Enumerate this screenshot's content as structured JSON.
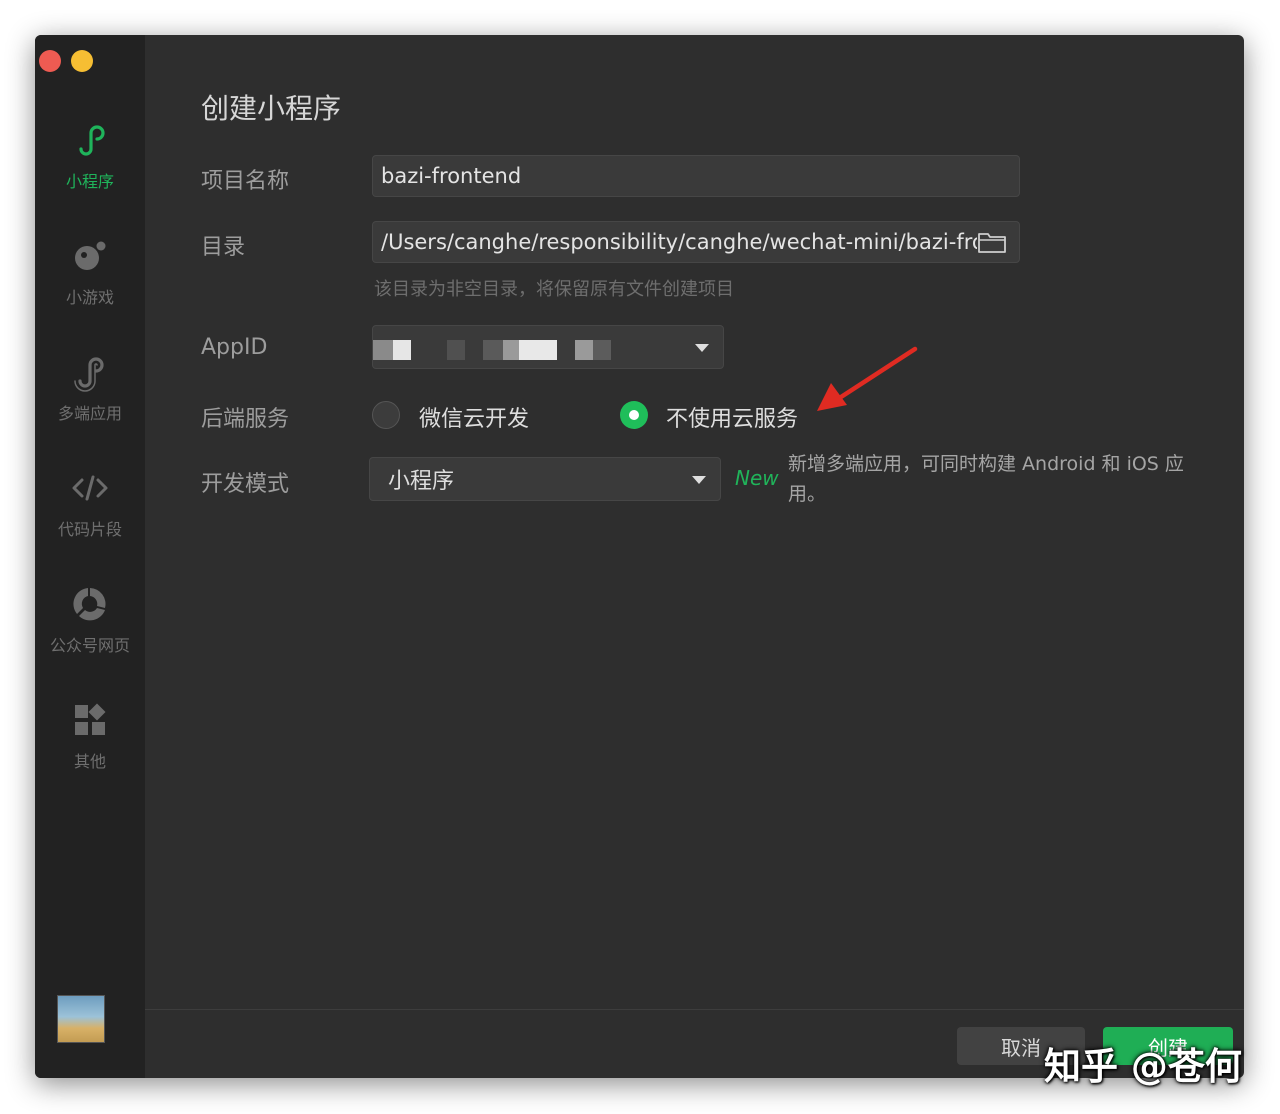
{
  "sidebar": {
    "items": [
      {
        "label": "小程序",
        "icon": "miniprogram-icon",
        "active": true
      },
      {
        "label": "小游戏",
        "icon": "game-icon",
        "active": false
      },
      {
        "label": "多端应用",
        "icon": "multi-platform-icon",
        "active": false
      },
      {
        "label": "代码片段",
        "icon": "code-icon",
        "active": false
      },
      {
        "label": "公众号网页",
        "icon": "official-account-icon",
        "active": false
      },
      {
        "label": "其他",
        "icon": "grid-icon",
        "active": false
      }
    ]
  },
  "main": {
    "title": "创建小程序",
    "project_name": {
      "label": "项目名称",
      "value": "bazi-frontend"
    },
    "directory": {
      "label": "目录",
      "value": "/Users/canghe/responsibility/canghe/wechat-mini/bazi-fro",
      "hint": "该目录为非空目录，将保留原有文件创建项目"
    },
    "appid": {
      "label": "AppID"
    },
    "backend": {
      "label": "后端服务",
      "options": [
        {
          "label": "微信云开发",
          "selected": false
        },
        {
          "label": "不使用云服务",
          "selected": true
        }
      ]
    },
    "dev_mode": {
      "label": "开发模式",
      "value": "小程序",
      "badge": "New",
      "description": "新增多端应用，可同时构建 Android 和 iOS 应用。"
    }
  },
  "footer": {
    "cancel_label": "取消",
    "create_label": "创建"
  },
  "watermark": "知乎 @苍何",
  "colors": {
    "accent": "#1fb45b",
    "window_bg": "#2e2e2e",
    "sidebar_bg": "#222222",
    "annotation_arrow": "#e02b22"
  }
}
